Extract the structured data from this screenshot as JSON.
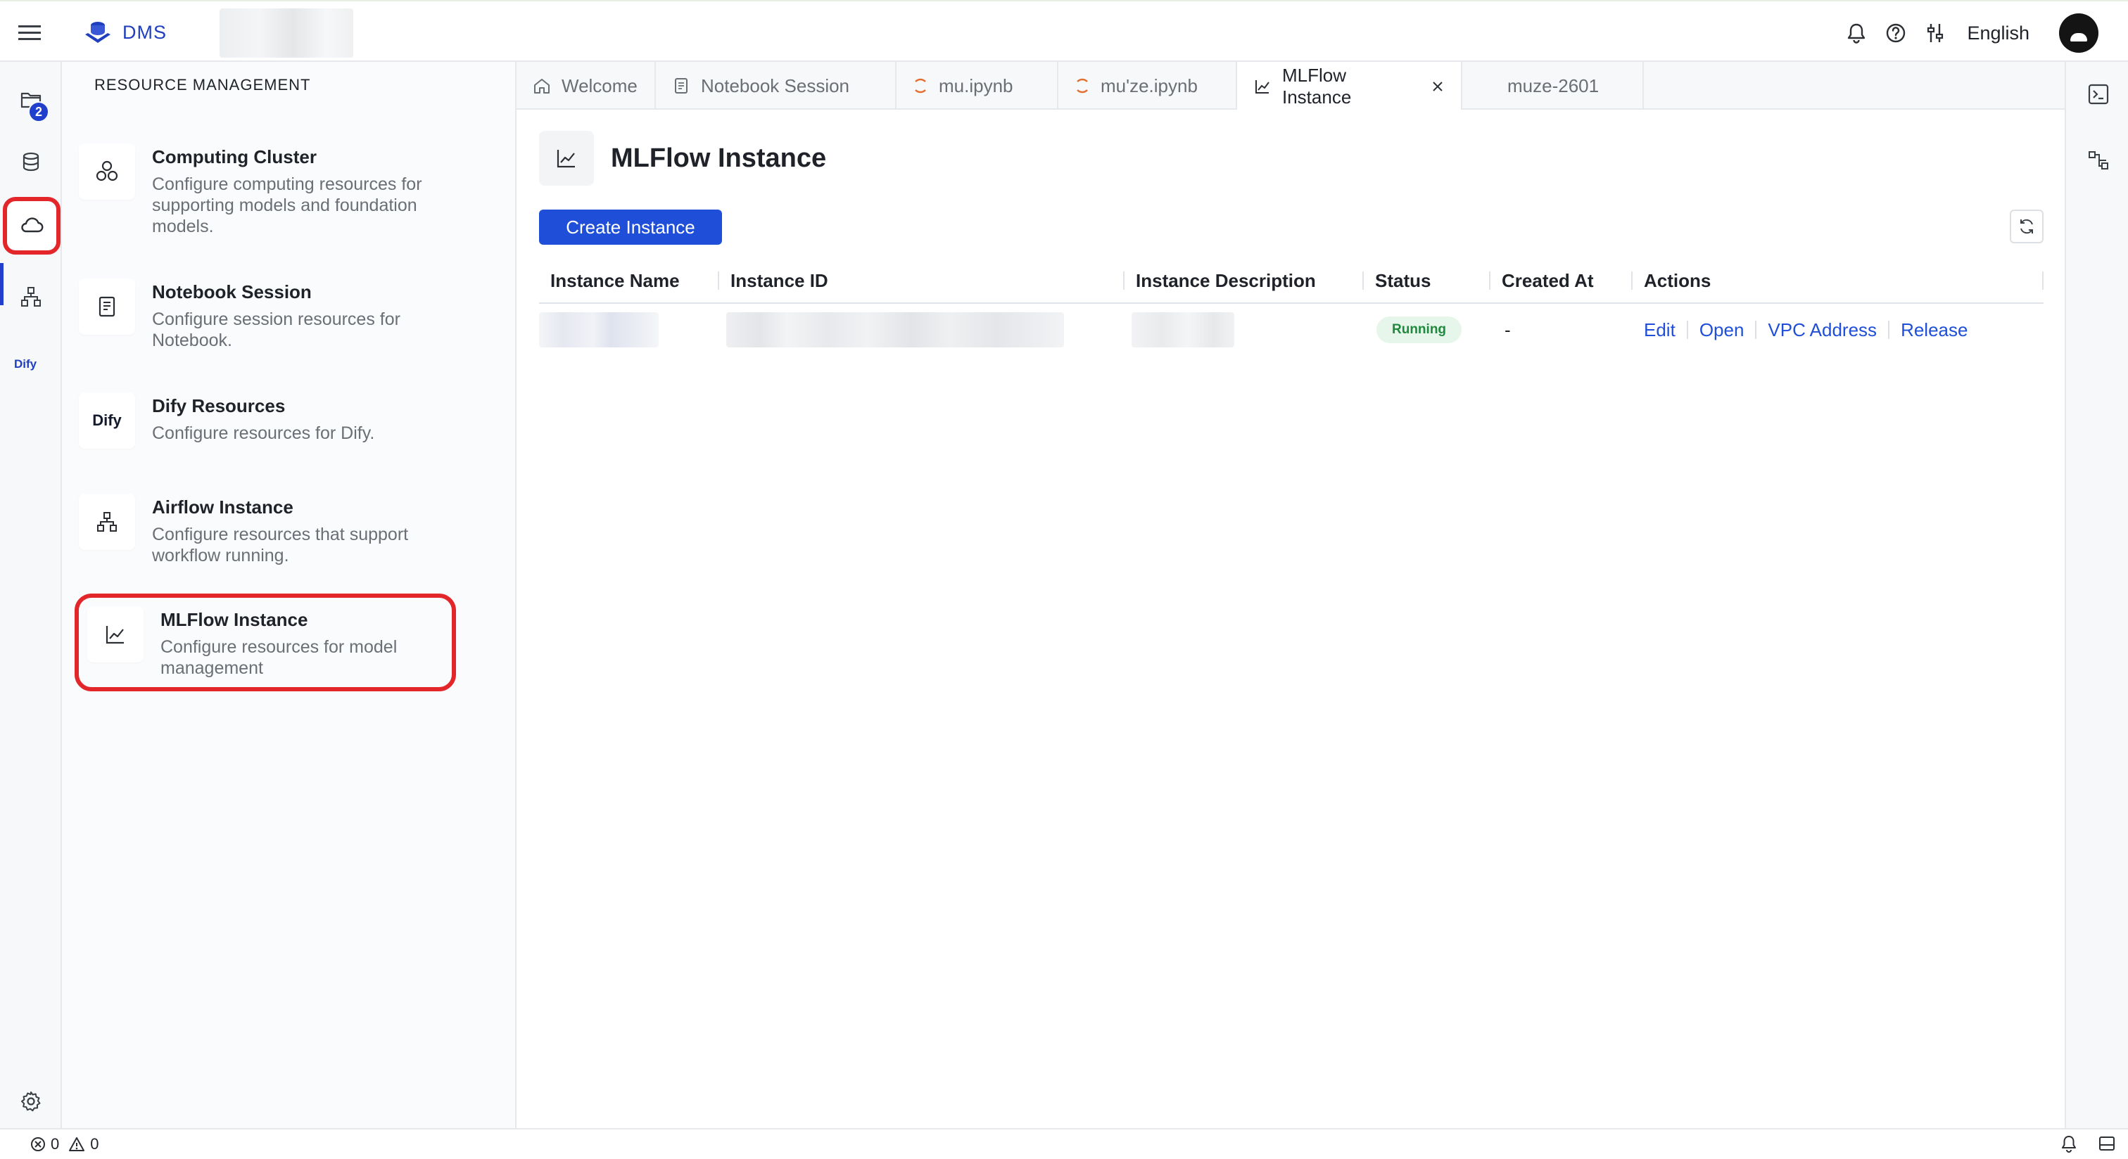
{
  "app": {
    "brand": "DMS",
    "language": "English",
    "accent": "#1f4fd8",
    "highlight": "#e2262a"
  },
  "rail": {
    "files_badge": "2",
    "items": [
      "folder-icon",
      "database-icon",
      "cloud-icon",
      "workflow-icon",
      "dify-icon"
    ],
    "dify_label": "Dify",
    "active": "cloud-icon"
  },
  "resources": {
    "title": "RESOURCE MANAGEMENT",
    "items": [
      {
        "name": "Computing Cluster",
        "desc": [
          "Configure computing resources for",
          "supporting models and foundation",
          "models."
        ],
        "icon": "cluster-icon"
      },
      {
        "name": "Notebook Session",
        "desc": [
          "Configure session resources for",
          "Notebook."
        ],
        "icon": "notebook-icon"
      },
      {
        "name": "Dify Resources",
        "desc": [
          "Configure resources for Dify."
        ],
        "icon": "dify-icon",
        "logo": "Dify"
      },
      {
        "name": "Airflow Instance",
        "desc": [
          "Configure resources that support",
          "workflow running."
        ],
        "icon": "airflow-icon"
      },
      {
        "name": "MLFlow Instance",
        "desc": [
          "Configure resources for model",
          "management"
        ],
        "icon": "chart-line-icon"
      }
    ],
    "selected": "MLFlow Instance"
  },
  "tabs": [
    {
      "label": "Welcome",
      "icon": "home-icon",
      "active": false
    },
    {
      "label": "Notebook Session",
      "icon": "notebook-icon",
      "active": false
    },
    {
      "label": "mu.ipynb",
      "icon": "jupyter-icon",
      "active": false
    },
    {
      "label": "mu'ze.ipynb",
      "icon": "jupyter-icon",
      "active": false
    },
    {
      "label": "MLFlow Instance",
      "icon": "chart-line-icon",
      "active": true
    },
    {
      "label": "muze-2601",
      "icon": "",
      "active": false
    }
  ],
  "main": {
    "title": "MLFlow Instance",
    "create_label": "Create Instance",
    "columns": [
      "Instance Name",
      "Instance ID",
      "Instance Description",
      "Status",
      "Created At",
      "Actions"
    ],
    "rows": [
      {
        "status": "Running",
        "created_at": "-",
        "actions": [
          "Edit",
          "Open",
          "VPC Address",
          "Release"
        ]
      }
    ]
  },
  "statusbar": {
    "errors": "0",
    "warnings": "0"
  }
}
